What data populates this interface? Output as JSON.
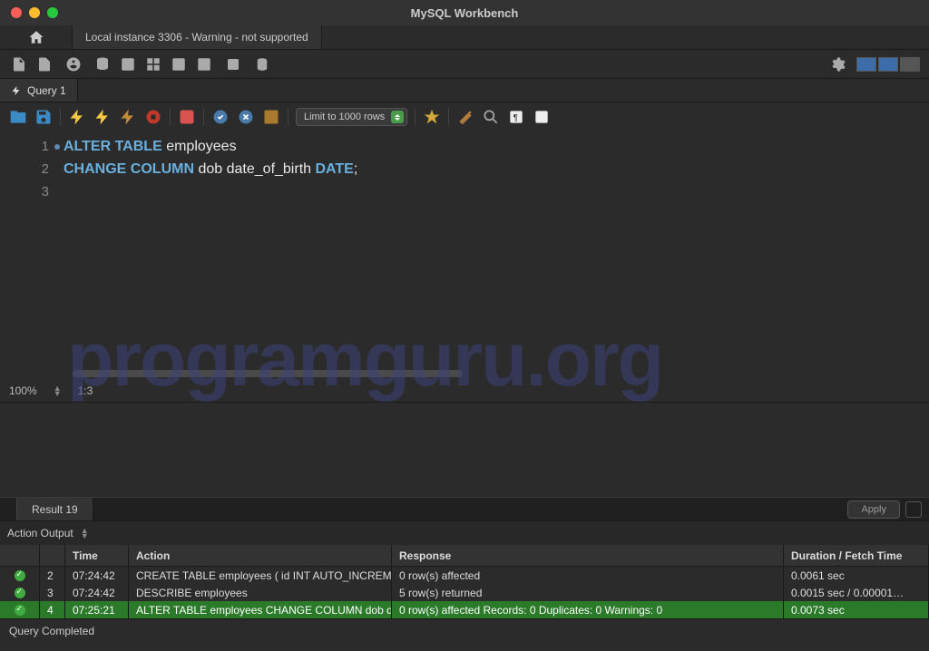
{
  "title": "MySQL Workbench",
  "connection_tab": "Local instance 3306 - Warning - not supported",
  "query_tab": "Query 1",
  "limit_rows": "Limit to 1000 rows",
  "code_tokens": {
    "l1a": "ALTER",
    "l1b": "TABLE",
    "l1c": "employees",
    "l2a": "CHANGE",
    "l2b": "COLUMN",
    "l2c": "dob",
    "l2d": "date_of_birth",
    "l2e": "DATE",
    "l2f": ";"
  },
  "gutter": [
    "1",
    "2",
    "3"
  ],
  "zoom": "100%",
  "cursor_pos": "1:3",
  "result_tab": "Result 19",
  "apply_label": "Apply",
  "action_output_label": "Action Output",
  "output": {
    "headers": {
      "time": "Time",
      "action": "Action",
      "response": "Response",
      "duration": "Duration / Fetch Time"
    },
    "rows": [
      {
        "idx": "2",
        "time": "07:24:42",
        "action": "CREATE TABLE employees (      id INT AUTO_INCREM…",
        "response": "0 row(s) affected",
        "duration": "0.0061 sec",
        "selected": false
      },
      {
        "idx": "3",
        "time": "07:24:42",
        "action": "DESCRIBE employees",
        "response": "5 row(s) returned",
        "duration": "0.0015 sec / 0.00001…",
        "selected": false
      },
      {
        "idx": "4",
        "time": "07:25:21",
        "action": "ALTER TABLE employees CHANGE COLUMN dob dat…",
        "response": "0 row(s) affected Records: 0  Duplicates: 0  Warnings: 0",
        "duration": "0.0073 sec",
        "selected": true
      }
    ]
  },
  "status_message": "Query Completed",
  "watermark": "programguru.org"
}
